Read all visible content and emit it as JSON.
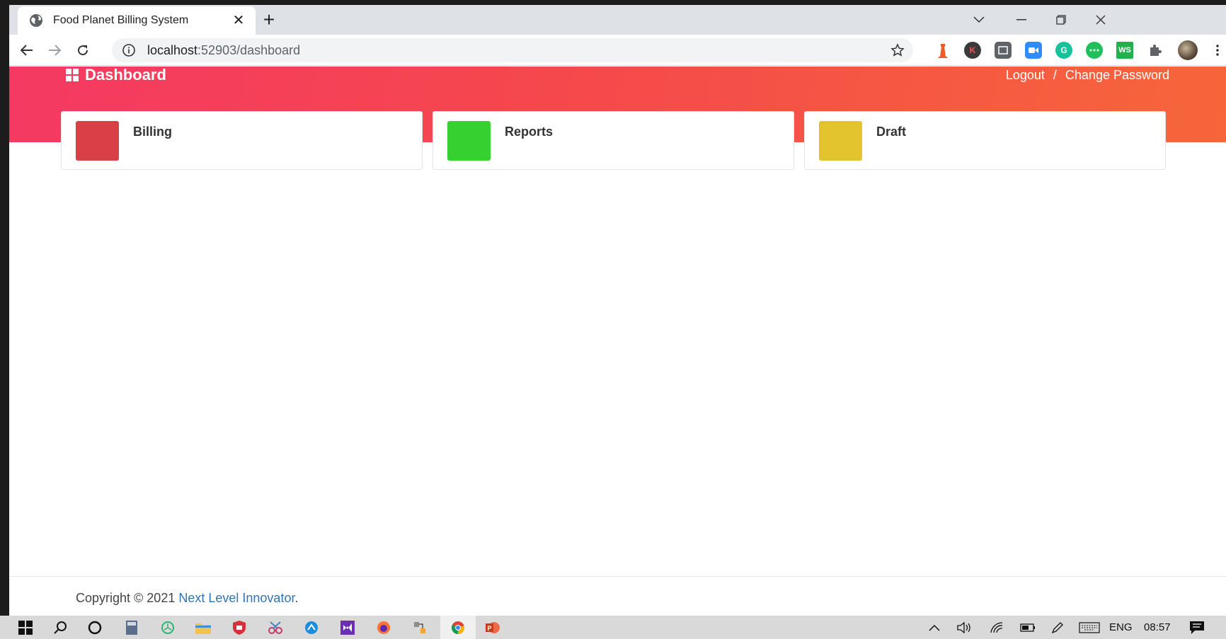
{
  "browser": {
    "tab_title": "Food Planet Billing System",
    "url_host": "localhost",
    "url_path": ":52903/dashboard"
  },
  "header": {
    "title": "Dashboard",
    "logout": "Logout",
    "separator": "/",
    "change_password": "Change Password"
  },
  "cards": [
    {
      "label": "Billing",
      "color": "#d94045"
    },
    {
      "label": "Reports",
      "color": "#36d130"
    },
    {
      "label": "Draft",
      "color": "#e3c42e"
    }
  ],
  "footer": {
    "prefix": "Copyright © 2021 ",
    "link": "Next Level Innovator",
    "suffix": "."
  },
  "taskbar": {
    "language": "ENG",
    "time": "08:57"
  },
  "colors": {
    "header_start": "#f53963",
    "header_end": "#f6663a"
  }
}
